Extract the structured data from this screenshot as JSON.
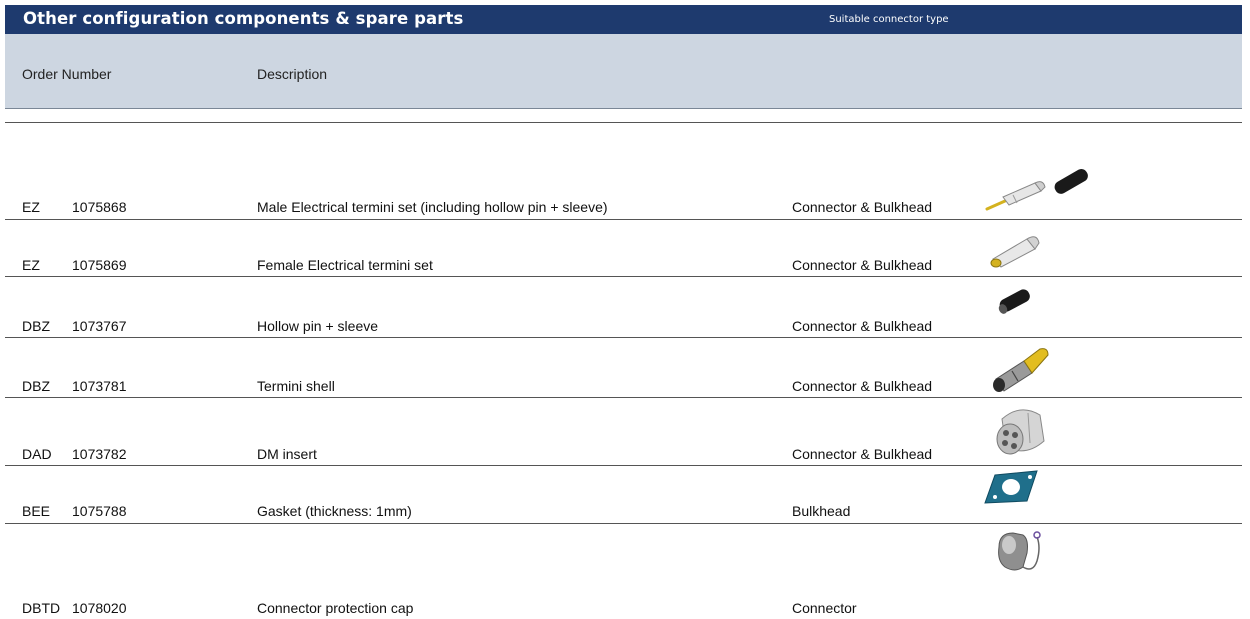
{
  "header": {
    "title": "Other configuration components & spare parts",
    "subtitle": "Suitable connector type",
    "columns": {
      "order_number": "Order Number",
      "description": "Description"
    }
  },
  "rows": [
    {
      "prefix": "EZ",
      "number": "1075868",
      "description": "Male Electrical termini set (including hollow pin + sleeve)",
      "connector_type": "Connector & Bulkhead",
      "image": "male-termini-set-icon"
    },
    {
      "prefix": "EZ",
      "number": "1075869",
      "description": "Female Electrical termini set",
      "connector_type": "Connector & Bulkhead",
      "image": "female-termini-set-icon"
    },
    {
      "prefix": "DBZ",
      "number": "1073767",
      "description": "Hollow pin + sleeve",
      "connector_type": "Connector & Bulkhead",
      "image": "hollow-pin-sleeve-icon"
    },
    {
      "prefix": "DBZ",
      "number": "1073781",
      "description": "Termini shell",
      "connector_type": "Connector & Bulkhead",
      "image": "termini-shell-icon"
    },
    {
      "prefix": "DAD",
      "number": "1073782",
      "description": "DM insert",
      "connector_type": "Connector & Bulkhead",
      "image": "dm-insert-icon"
    },
    {
      "prefix": "BEE",
      "number": "1075788",
      "description": "Gasket (thickness: 1mm)",
      "connector_type": "Bulkhead",
      "image": "gasket-icon"
    },
    {
      "prefix": "DBTD",
      "number": "1078020",
      "description": "Connector protection cap",
      "connector_type": "Connector",
      "image": "protection-cap-icon"
    }
  ],
  "colors": {
    "title_bar": "#1e3a6e",
    "header_band": "#cdd6e1",
    "gasket": "#1f6f8b",
    "gold": "#d4b21f"
  }
}
